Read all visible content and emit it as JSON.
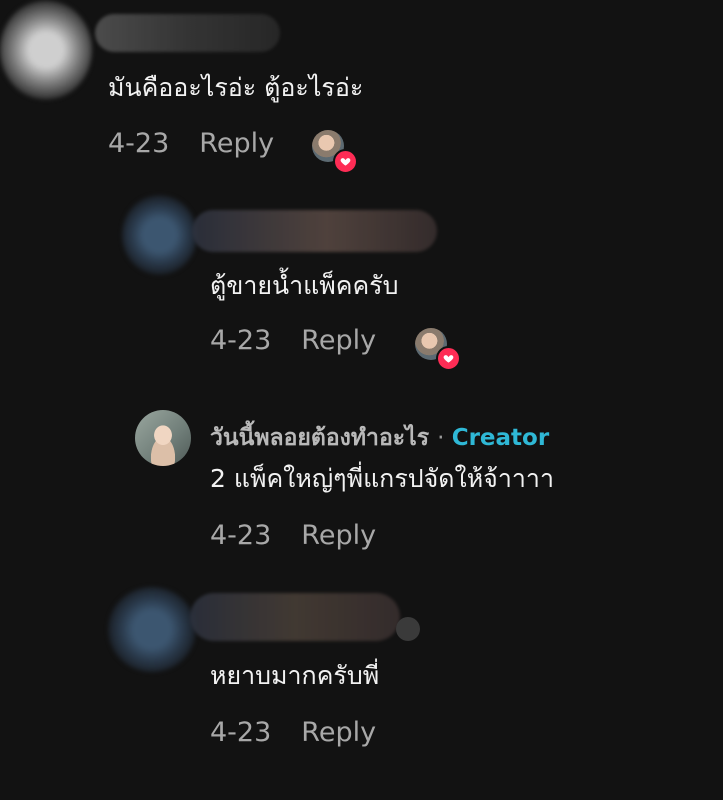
{
  "comments": [
    {
      "text": "มันคืออะไรอ่ะ ตู้อะไรอ่ะ",
      "date": "4-23",
      "reply_label": "Reply"
    },
    {
      "text": "ตู้ขายน้ำแพ็คครับ",
      "date": "4-23",
      "reply_label": "Reply"
    },
    {
      "username": "วันนี้พลอยต้องทำอะไร",
      "separator": "·",
      "badge": "Creator",
      "text": "2 แพ็คใหญ่ๆพี่แกรปจัดให้จ้าาาา",
      "date": "4-23",
      "reply_label": "Reply"
    },
    {
      "text": "หยาบมากครับพี่",
      "date": "4-23",
      "reply_label": "Reply"
    }
  ],
  "icons": {
    "heart": "heart-icon",
    "like_color": "#fe2c55",
    "creator_color": "#2fb8d6"
  }
}
